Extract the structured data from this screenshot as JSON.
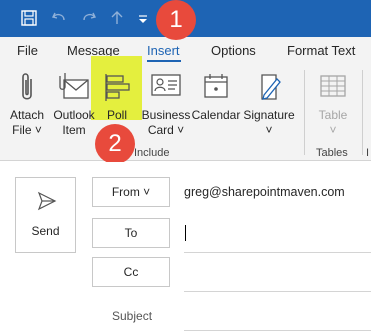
{
  "tabs": [
    {
      "label": "File"
    },
    {
      "label": "Message"
    },
    {
      "label": "Insert"
    },
    {
      "label": "Options"
    },
    {
      "label": "Format Text"
    }
  ],
  "active_tab": "Insert",
  "ribbon": {
    "attach_file": {
      "line1": "Attach",
      "line2": "File ˅"
    },
    "outlook_item": {
      "line1": "Outlook",
      "line2": "Item"
    },
    "poll": {
      "line1": "Poll"
    },
    "business_card": {
      "line1": "Business",
      "line2": "Card ˅"
    },
    "calendar": {
      "line1": "Calendar"
    },
    "signature": {
      "line1": "Signature",
      "line2": "˅"
    },
    "table": {
      "line1": "Table",
      "line2": "˅"
    },
    "group_include": "Include",
    "group_tables": "Tables",
    "group_cut": "I"
  },
  "callouts": {
    "one": "1",
    "two": "2"
  },
  "compose": {
    "send_label": "Send",
    "from_label": "From ˅",
    "from_value": "greg@sharepointmaven.com",
    "to_label": "To",
    "cc_label": "Cc",
    "subject_label": "Subject"
  },
  "colors": {
    "title_bar": "#1e64b4",
    "accent": "#1e64b4",
    "highlight": "#e4ef3e",
    "callout": "#e84a3c"
  }
}
